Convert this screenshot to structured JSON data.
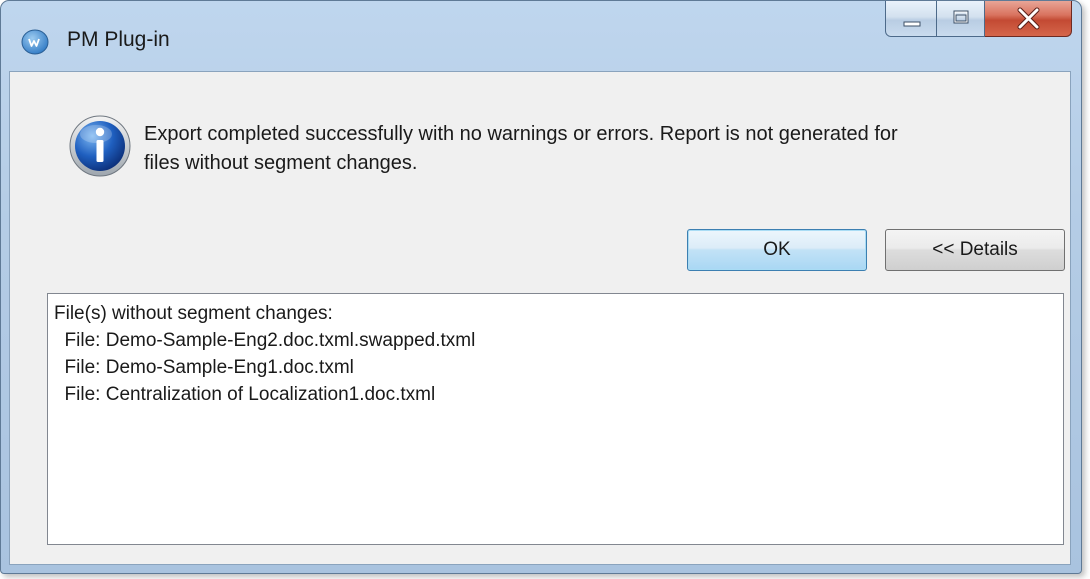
{
  "window": {
    "title": "PM Plug-in",
    "icon": "pm-plugin-app-icon"
  },
  "caption_buttons": {
    "minimize_icon": "minimize-icon",
    "maximize_icon": "maximize-icon",
    "close_icon": "close-icon"
  },
  "dialog": {
    "icon": "information-icon",
    "message_line1": "Export completed successfully with no warnings or errors. Report is not generated for",
    "message_line2": "files without segment changes."
  },
  "buttons": {
    "ok_label": "OK",
    "details_label": "<< Details"
  },
  "details": {
    "lines": [
      "File(s) without segment changes:",
      "  File: Demo-Sample-Eng2.doc.txml.swapped.txml",
      "  File: Demo-Sample-Eng1.doc.txml",
      "  File: Centralization of Localization1.doc.txml"
    ]
  },
  "colors": {
    "titlebar": "#b5cde6",
    "client_background": "#f0f0f0",
    "close_button": "#c34a33",
    "default_button_border": "#3c7fb1"
  }
}
